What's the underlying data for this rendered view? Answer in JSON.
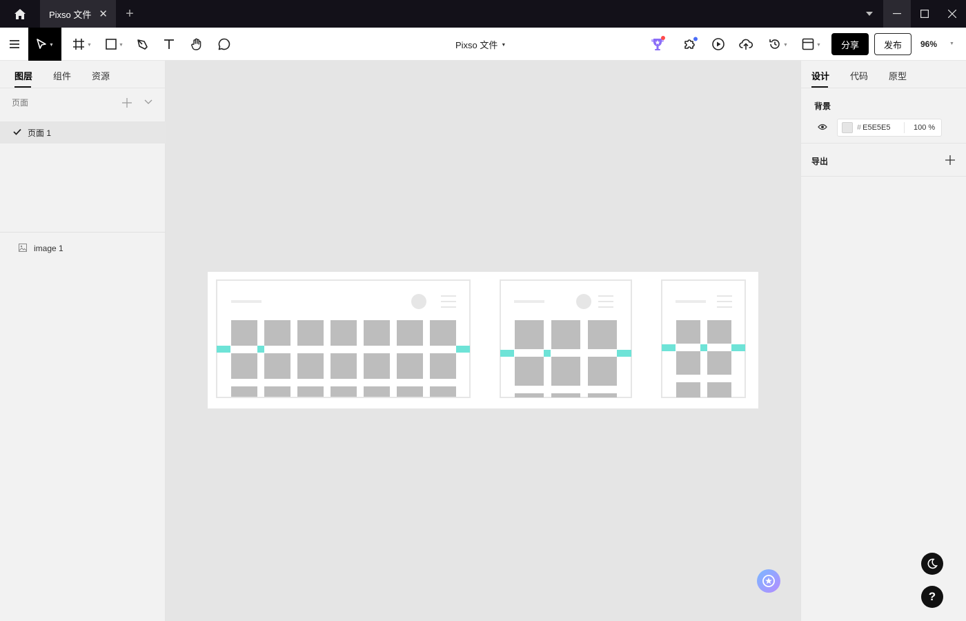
{
  "titlebar": {
    "tab_title": "Pixso 文件",
    "close_glyph": "✕",
    "new_tab_glyph": "+"
  },
  "toolbar": {
    "doc_title": "Pixso 文件",
    "share_label": "分享",
    "publish_label": "发布",
    "zoom": "96%"
  },
  "left_panel": {
    "tabs": [
      "图层",
      "组件",
      "资源"
    ],
    "pages_label": "页面",
    "pages": [
      "页面 1"
    ],
    "layers": [
      "image 1"
    ]
  },
  "right_panel": {
    "tabs": [
      "设计",
      "代码",
      "原型"
    ],
    "background_label": "背景",
    "background_hex_prefix": "#",
    "background_hex": "E5E5E5",
    "background_opacity": "100 %",
    "export_label": "导出",
    "colors": {
      "canvas": "#E5E5E5",
      "accent_teal": "#6EE3D7",
      "placeholder_gray": "#BDBDBD"
    }
  },
  "icons": {
    "titlebar": [
      "home-icon",
      "close-icon",
      "plus-icon",
      "chevron-down-icon",
      "minimize-icon",
      "maximize-icon",
      "window-close-icon"
    ],
    "toolbar": [
      "menu-icon",
      "move-tool-icon",
      "frame-tool-icon",
      "rectangle-tool-icon",
      "pen-tool-icon",
      "text-tool-icon",
      "hand-tool-icon",
      "comment-tool-icon",
      "trophy-icon",
      "plugin-icon",
      "play-icon",
      "upload-icon",
      "history-icon",
      "layout-icon"
    ],
    "floating": [
      "ai-assistant-icon",
      "dark-mode-icon",
      "help-icon"
    ]
  },
  "help_glyph": "?"
}
